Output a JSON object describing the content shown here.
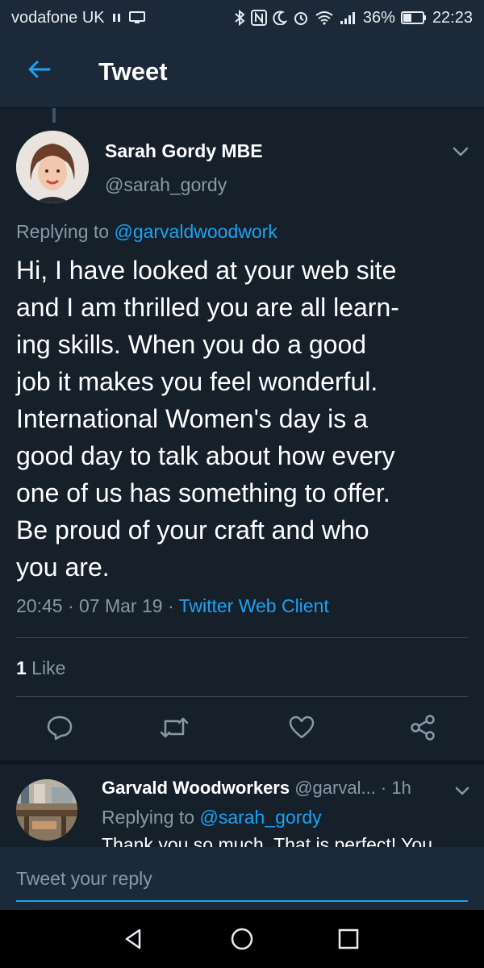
{
  "status_bar": {
    "carrier": "vodafone UK",
    "battery": "36%",
    "time": "22:23"
  },
  "header": {
    "title": "Tweet",
    "back_icon": "arrow-left-icon"
  },
  "tweet": {
    "author_name": "Sarah Gordy MBE",
    "author_handle": "@sarah_gordy",
    "replying_prefix": "Replying to",
    "replying_to": "@garvaldwoodwork",
    "body_lines": [
      "Hi,  I have looked at your web site",
      "and I am thrilled you are all learn-",
      "ing skills.  When you do a good",
      "job it makes you feel wonderful.",
      "International Women's day is a",
      "good day to talk about how every",
      "one of us has something to offer.",
      "Be proud of your craft and who",
      "you are."
    ],
    "timestamp": "20:45 · 07 Mar 19 · ",
    "source": "Twitter Web Client",
    "like_count": "1",
    "like_label": " Like"
  },
  "reply": {
    "author_name": "Garvald Woodworkers",
    "author_handle": " @garval...",
    "time": " · 1h",
    "replying_prefix": "Replying to",
    "replying_to": "@sarah_gordy",
    "text": "Thank you so much. That is perfect! You"
  },
  "compose": {
    "placeholder": "Tweet your reply"
  },
  "colors": {
    "background": "#15202b",
    "bar": "#1c2938",
    "accent": "#1da1f2",
    "muted": "#8899a6"
  }
}
